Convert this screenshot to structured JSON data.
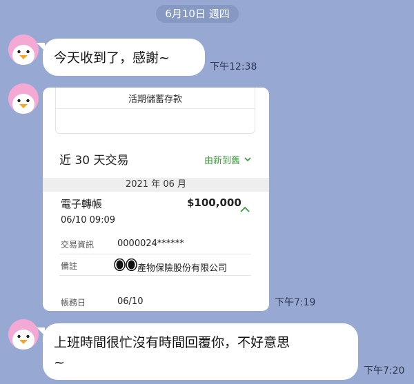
{
  "date_header": "6月10日 週四",
  "messages": [
    {
      "text": "今天收到了，感謝~",
      "time": "下午12:38"
    },
    {
      "time": "下午7:19"
    },
    {
      "text_line1": "上班時間很忙沒有時間回覆你，不好意思",
      "text_line2": "~",
      "time": "下午7:20"
    }
  ],
  "card": {
    "account_name": "活期儲蓄存款",
    "section_title": "近 30 天交易",
    "sort_label": "由新到舊",
    "month_header": "2021 年 06 月",
    "transaction": {
      "name": "電子轉帳",
      "amount": "$100,000",
      "datetime": "06/10 09:09",
      "details": [
        {
          "label": "交易資訊",
          "value": "0000024******"
        },
        {
          "label": "備註",
          "value": "產物保險股份有限公司"
        },
        {
          "label": "帳務日",
          "value": "06/10"
        }
      ]
    }
  },
  "icons": {
    "avatar": "penguin-avatar",
    "sort": "chevron-down-icon",
    "collapse": "chevron-up-icon",
    "redaction": "redaction-dots"
  },
  "colors": {
    "background": "#97a9d3",
    "bubble": "#ffffff",
    "avatar_bg": "#f3a9d4",
    "accent_green": "#3a9a3a"
  }
}
